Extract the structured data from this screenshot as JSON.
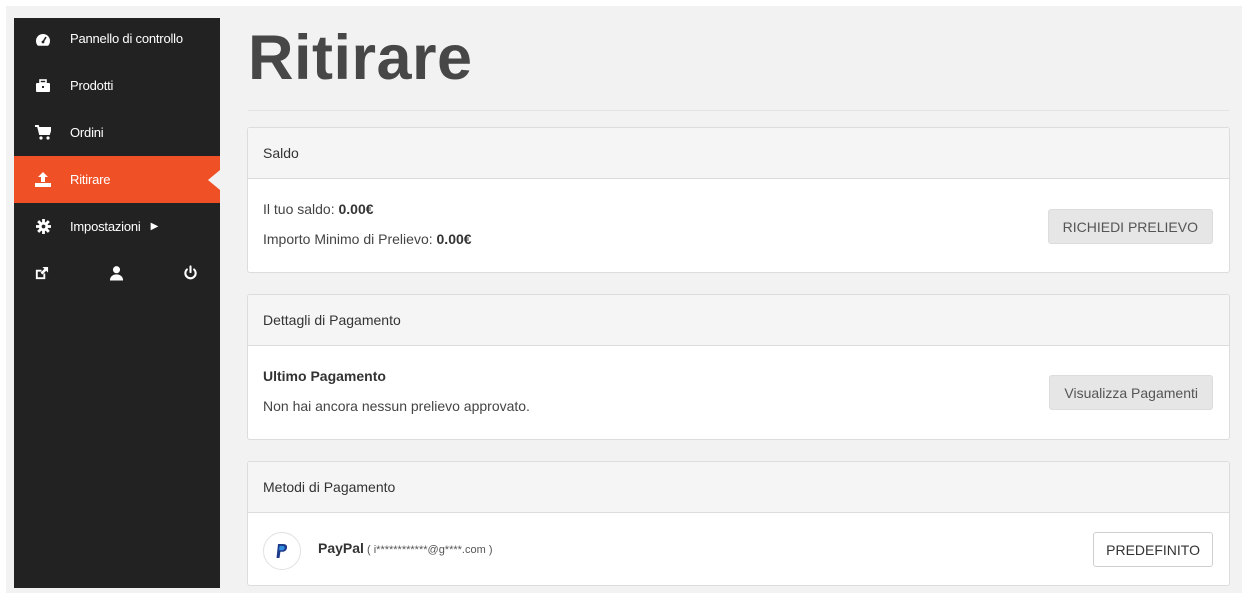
{
  "sidebar": {
    "items": [
      {
        "label": "Pannello di controllo",
        "icon": "dashboard-icon"
      },
      {
        "label": "Prodotti",
        "icon": "briefcase-icon"
      },
      {
        "label": "Ordini",
        "icon": "cart-icon"
      },
      {
        "label": "Ritirare",
        "icon": "upload-icon",
        "active": true
      },
      {
        "label": "Impostazioni",
        "icon": "gear-icon"
      }
    ],
    "icons": [
      "external-link-icon",
      "user-icon",
      "power-icon"
    ]
  },
  "page": {
    "title": "Ritirare"
  },
  "balance": {
    "header": "Saldo",
    "label_balance": "Il tuo saldo: ",
    "balance_value": "0.00€",
    "label_min": "Importo Minimo di Prelievo: ",
    "min_value": "0.00€",
    "button": "RICHIEDI PRELIEVO"
  },
  "payment_details": {
    "header": "Dettagli di Pagamento",
    "last_payment_title": "Ultimo Pagamento",
    "last_payment_text": "Non hai ancora nessun prelievo approvato.",
    "button": "Visualizza Pagamenti"
  },
  "payment_methods": {
    "header": "Metodi di Pagamento",
    "method_name": "PayPal",
    "method_account": " ( i************@g****.com )",
    "button": "PREDEFINITO"
  },
  "colors": {
    "accent": "#f05025",
    "sidebar": "#222222"
  }
}
